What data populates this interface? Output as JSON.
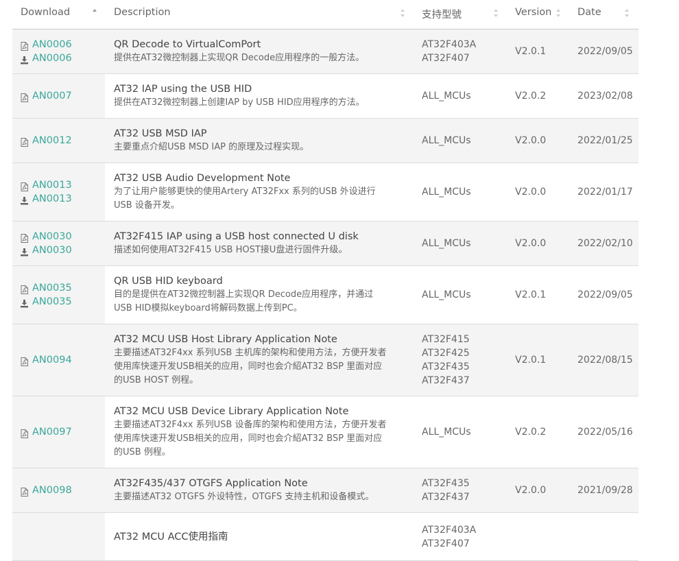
{
  "table": {
    "headers": {
      "download": "Download",
      "description": "Description",
      "models": "支持型號",
      "version": "Version",
      "date": "Date"
    },
    "rows": [
      {
        "links": [
          {
            "type": "pdf",
            "label": "AN0006"
          },
          {
            "type": "download",
            "label": "AN0006"
          }
        ],
        "title": "QR Decode to VirtualComPort",
        "desc": [
          "提供在AT32微控制器上实现QR Decode应用程序的一般方法。"
        ],
        "models": [
          "AT32F403A",
          "AT32F407"
        ],
        "version": "V2.0.1",
        "date": "2022/09/05"
      },
      {
        "links": [
          {
            "type": "pdf",
            "label": "AN0007"
          }
        ],
        "title": "AT32 IAP using the USB HID",
        "desc": [
          "提供在AT32微控制器上创建IAP by USB HID应用程序的方法。"
        ],
        "models": [
          "ALL_MCUs"
        ],
        "version": "V2.0.2",
        "date": "2023/02/08"
      },
      {
        "links": [
          {
            "type": "pdf",
            "label": "AN0012"
          }
        ],
        "title": "AT32 USB MSD IAP",
        "desc": [
          "主要重点介紹USB MSD IAP 的原理及过程实现。"
        ],
        "models": [
          "ALL_MCUs"
        ],
        "version": "V2.0.0",
        "date": "2022/01/25"
      },
      {
        "links": [
          {
            "type": "pdf",
            "label": "AN0013"
          },
          {
            "type": "download",
            "label": "AN0013"
          }
        ],
        "title": "AT32 USB Audio Development Note",
        "desc": [
          "为了让用户能够更快的使用Artery AT32Fxx 系列的USB 外设进行",
          "USB 设备开发。"
        ],
        "models": [
          "ALL_MCUs"
        ],
        "version": "V2.0.0",
        "date": "2022/01/17"
      },
      {
        "links": [
          {
            "type": "pdf",
            "label": "AN0030"
          },
          {
            "type": "download",
            "label": "AN0030"
          }
        ],
        "title": "AT32F415 IAP using a USB host connected U disk",
        "desc": [
          "描述如何使用AT32F415 USB HOST接U盘进行固件升级。"
        ],
        "models": [
          "ALL_MCUs"
        ],
        "version": "V2.0.0",
        "date": "2022/02/10"
      },
      {
        "links": [
          {
            "type": "pdf",
            "label": "AN0035"
          },
          {
            "type": "download",
            "label": "AN0035"
          }
        ],
        "title": "QR USB HID keyboard",
        "desc": [
          "目的是提供在AT32微控制器上实现QR Decode应用程序，并通过",
          "USB HID模拟keyboard将解码数据上传到PC。"
        ],
        "models": [
          "ALL_MCUs"
        ],
        "version": "V2.0.1",
        "date": "2022/09/05"
      },
      {
        "links": [
          {
            "type": "pdf",
            "label": "AN0094"
          }
        ],
        "title": "AT32 MCU USB Host Library Application Note",
        "desc": [
          "主要描述AT32F4xx 系列USB 主机库的架构和使用方法，方便开发者",
          "使用库快速开发USB相关的应用，同时也会介紹AT32 BSP 里面对应",
          "的USB HOST 例程。"
        ],
        "models": [
          "AT32F415",
          "AT32F425",
          "AT32F435",
          "AT32F437"
        ],
        "version": "V2.0.1",
        "date": "2022/08/15"
      },
      {
        "links": [
          {
            "type": "pdf",
            "label": "AN0097"
          }
        ],
        "title": "AT32 MCU USB Device Library Application Note",
        "desc": [
          "主要描述AT32F4xx 系列USB 设备库的架构和使用方法，方便开发者",
          "使用库快速开发USB相关的应用，同时也会介紹AT32 BSP 里面对应",
          "的USB 例程。"
        ],
        "models": [
          "ALL_MCUs"
        ],
        "version": "V2.0.2",
        "date": "2022/05/16"
      },
      {
        "links": [
          {
            "type": "pdf",
            "label": "AN0098"
          }
        ],
        "title": "AT32F435/437 OTGFS Application Note",
        "desc": [
          "主要描述AT32 OTGFS 外设特性，OTGFS 支持主机和设备模式。"
        ],
        "models": [
          "AT32F435",
          "AT32F437"
        ],
        "version": "V2.0.0",
        "date": "2021/09/28"
      },
      {
        "links": [],
        "title": "AT32 MCU ACC使用指南",
        "desc": [],
        "models": [
          "AT32F403A",
          "AT32F407"
        ],
        "version": "",
        "date": ""
      }
    ]
  },
  "colors": {
    "link": "#3aa79a",
    "stripe": "#f4f4f4",
    "border": "#dcdcdc"
  },
  "icons": {
    "pdf": "pdf-file-icon",
    "download": "download-icon"
  }
}
